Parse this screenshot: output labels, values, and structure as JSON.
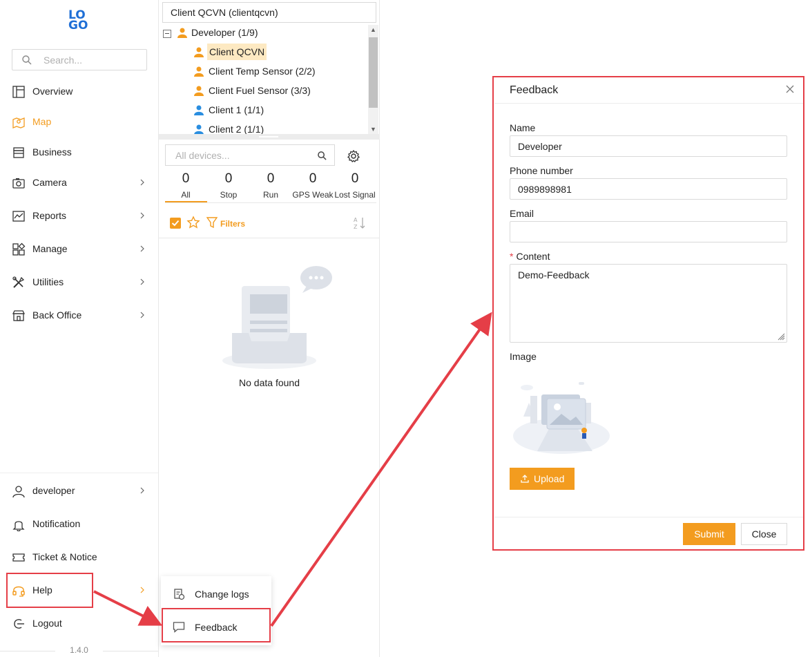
{
  "logo": {
    "line1": "LO",
    "line2": "GO"
  },
  "sidebar": {
    "search_placeholder": "Search...",
    "items": [
      {
        "label": "Overview",
        "icon": "layout-icon",
        "has_submenu": false,
        "active": false
      },
      {
        "label": "Map",
        "icon": "map-icon",
        "has_submenu": false,
        "active": true
      },
      {
        "label": "Business",
        "icon": "store-icon",
        "has_submenu": false,
        "active": false
      },
      {
        "label": "Camera",
        "icon": "camera-icon",
        "has_submenu": true,
        "active": false
      },
      {
        "label": "Reports",
        "icon": "chart-icon",
        "has_submenu": true,
        "active": false
      },
      {
        "label": "Manage",
        "icon": "grid-icon",
        "has_submenu": true,
        "active": false
      },
      {
        "label": "Utilities",
        "icon": "tools-icon",
        "has_submenu": true,
        "active": false
      },
      {
        "label": "Back Office",
        "icon": "shop-icon",
        "has_submenu": true,
        "active": false
      }
    ],
    "bottom_items": [
      {
        "label": "developer",
        "icon": "user-icon",
        "has_submenu": true
      },
      {
        "label": "Notification",
        "icon": "bell-icon",
        "has_submenu": false
      },
      {
        "label": "Ticket & Notice",
        "icon": "ticket-icon",
        "has_submenu": false
      },
      {
        "label": "Help",
        "icon": "headset-icon",
        "has_submenu": true
      },
      {
        "label": "Logout",
        "icon": "logout-icon",
        "has_submenu": false
      }
    ],
    "version": "1.4.0"
  },
  "middle": {
    "client_select": "Client QCVN (clientqcvn)",
    "tree": [
      {
        "label": "Developer (1/9)",
        "level": 0,
        "icon_color": "#f39c1f",
        "selected": false
      },
      {
        "label": "Client QCVN",
        "level": 1,
        "icon_color": "#f39c1f",
        "selected": true
      },
      {
        "label": "Client Temp Sensor (2/2)",
        "level": 1,
        "icon_color": "#f39c1f",
        "selected": false
      },
      {
        "label": "Client Fuel Sensor (3/3)",
        "level": 1,
        "icon_color": "#f39c1f",
        "selected": false
      },
      {
        "label": "Client 1 (1/1)",
        "level": 1,
        "icon_color": "#2a8ee0",
        "selected": false
      },
      {
        "label": "Client 2 (1/1)",
        "level": 1,
        "icon_color": "#2a8ee0",
        "selected": false
      }
    ],
    "device_search_placeholder": "All devices...",
    "stats": [
      {
        "count": "0",
        "label": "All"
      },
      {
        "count": "0",
        "label": "Stop"
      },
      {
        "count": "0",
        "label": "Run"
      },
      {
        "count": "0",
        "label": "GPS Weak"
      },
      {
        "count": "0",
        "label": "Lost Signal"
      }
    ],
    "filters_label": "Filters",
    "empty_text": "No data found"
  },
  "help_menu": [
    {
      "label": "Change logs",
      "icon": "changelog-icon"
    },
    {
      "label": "Feedback",
      "icon": "comment-icon"
    }
  ],
  "feedback": {
    "title": "Feedback",
    "name_label": "Name",
    "name_value": "Developer",
    "phone_label": "Phone number",
    "phone_value": "0989898981",
    "email_label": "Email",
    "email_value": "",
    "content_required_mark": "*",
    "content_label": "Content",
    "content_value": "Demo-Feedback",
    "image_label": "Image",
    "upload_label": "Upload",
    "submit_label": "Submit",
    "close_label": "Close"
  },
  "colors": {
    "accent": "#f39c1f",
    "highlight": "#e53e47",
    "logo": "#1f6fd6"
  }
}
